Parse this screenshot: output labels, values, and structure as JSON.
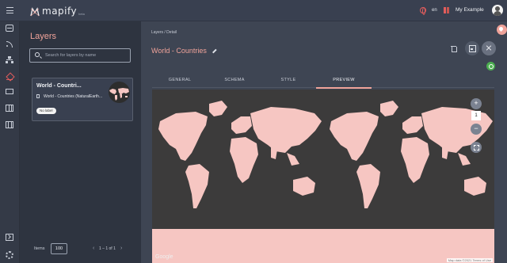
{
  "app": {
    "name": "mapify",
    "badge": "beta"
  },
  "header": {
    "language": "en",
    "user_name": "My Example"
  },
  "layers_panel": {
    "title": "Layers",
    "search_placeholder": "Search for layers by name",
    "card": {
      "title": "World - Countri...",
      "source": "World - Countries (NaturalEarth...",
      "label": "No label"
    },
    "pager": {
      "items_label": "Items",
      "items_value": "100",
      "range": "1 – 1 of 1",
      "prev": "‹",
      "next": "›"
    }
  },
  "detail": {
    "breadcrumb": "Layers / Detail",
    "title": "World - Countries",
    "tabs": [
      {
        "label": "GENERAL",
        "active": false
      },
      {
        "label": "SCHEMA",
        "active": false
      },
      {
        "label": "STYLE",
        "active": false
      },
      {
        "label": "PREVIEW",
        "active": true
      }
    ]
  },
  "map": {
    "zoom_in": "+",
    "zoom_out": "−",
    "zoom_level": "1",
    "google": "Google",
    "attribution": "Map data ©2021   Terms of Use",
    "land_color": "#f6c6c2",
    "water_color": "#3c3b3b"
  },
  "colors": {
    "accent": "#f0a39a",
    "success": "#4caf50"
  }
}
